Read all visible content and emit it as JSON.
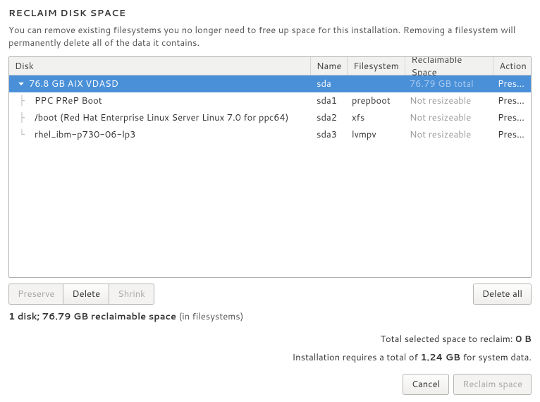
{
  "title": "RECLAIM DISK SPACE",
  "description": "You can remove existing filesystems you no longer need to free up space for this installation.  Removing a filesystem will permanently delete all of the data it contains.",
  "columns": {
    "disk": "Disk",
    "name": "Name",
    "fs": "Filesystem",
    "reclaimable": "Reclaimable Space",
    "action": "Action"
  },
  "rows": [
    {
      "type": "disk",
      "selected": true,
      "disk": "76.8 GB AIX VDASD",
      "name": "sda",
      "fs": "",
      "reclaimable": "76.79 GB total",
      "reclaimable_dim": true,
      "action": "Preserve"
    },
    {
      "type": "part",
      "glyph": "├",
      "disk": "PPC PReP Boot",
      "name": "sda1",
      "fs": "prepboot",
      "reclaimable": "Not resizeable",
      "reclaimable_dim": true,
      "action": "Preserve"
    },
    {
      "type": "part",
      "glyph": "├",
      "disk": "/boot (Red Hat Enterprise Linux Server Linux 7.0 for ppc64)",
      "name": "sda2",
      "fs": "xfs",
      "reclaimable": "Not resizeable",
      "reclaimable_dim": true,
      "action": "Preserve"
    },
    {
      "type": "part",
      "glyph": "└",
      "disk": "rhel_ibm-p730-06-lp3",
      "name": "sda3",
      "fs": "lvmpv",
      "reclaimable": "Not resizeable",
      "reclaimable_dim": true,
      "action": "Preserve"
    }
  ],
  "buttons": {
    "preserve": "Preserve",
    "delete": "Delete",
    "shrink": "Shrink",
    "delete_all": "Delete all",
    "cancel": "Cancel",
    "reclaim": "Reclaim space"
  },
  "status": {
    "disk_count": "1 disk; 76.79 GB reclaimable space",
    "disk_count_suffix": "(in filesystems)",
    "total_label": "Total selected space to reclaim:",
    "total_value": "0 B",
    "install_prefix": "Installation requires a total of",
    "install_value": "1.24 GB",
    "install_suffix": "for system data."
  }
}
